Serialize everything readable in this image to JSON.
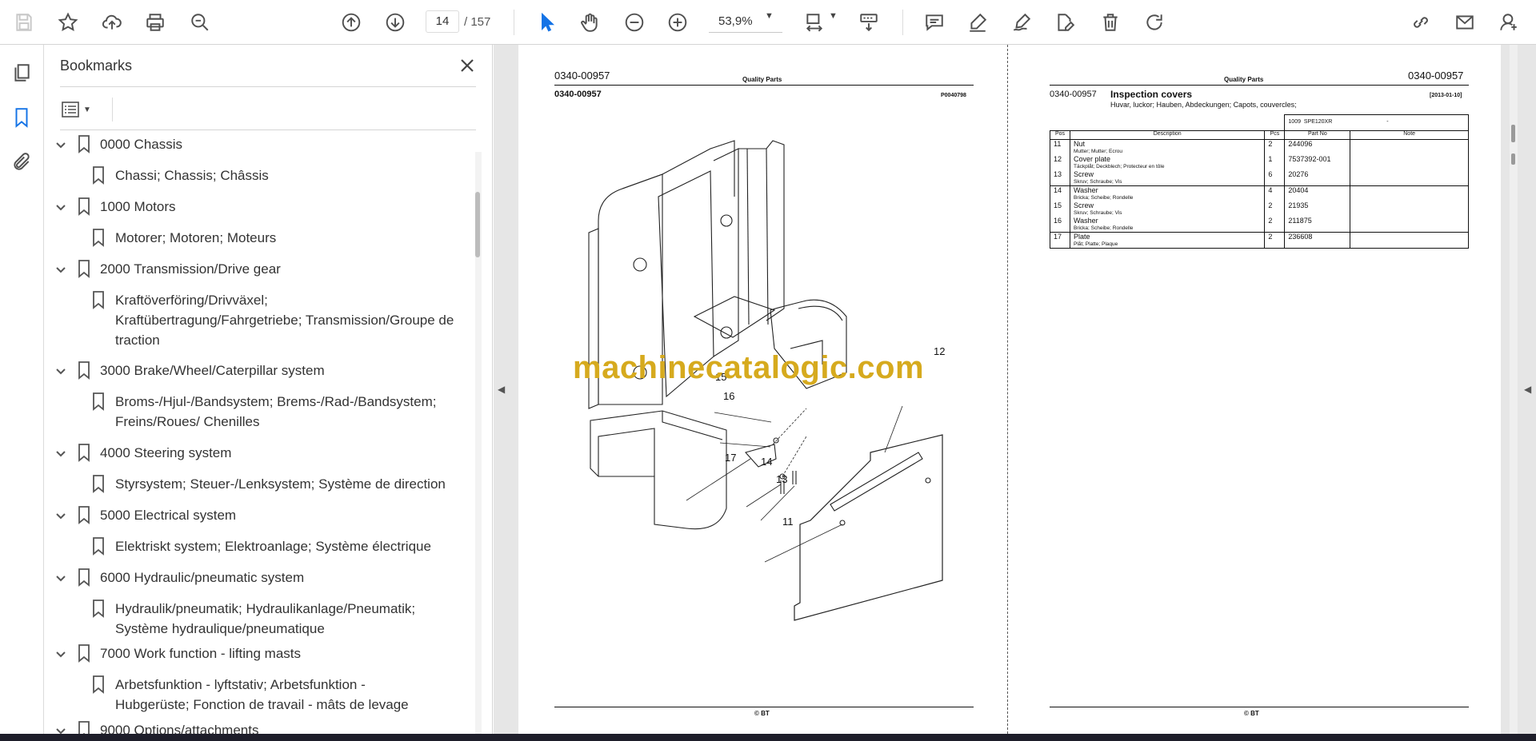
{
  "toolbar": {
    "page_current": "14",
    "page_total": "157",
    "page_separator": "/",
    "zoom": "53,9%"
  },
  "bookmarks": {
    "title": "Bookmarks",
    "items": [
      {
        "label": "0000 Chassis",
        "level": 0
      },
      {
        "label": "Chassi; Chassis; Châssis",
        "level": 1
      },
      {
        "label": "1000 Motors",
        "level": 0
      },
      {
        "label": "Motorer; Motoren; Moteurs",
        "level": 1
      },
      {
        "label": "2000 Transmission/Drive gear",
        "level": 0
      },
      {
        "label": "Kraftöverföring/Drivväxel;",
        "label2": "Kraftübertragung/Fahrgetriebe; Transmission/Groupe de",
        "label3": "traction",
        "level": 1
      },
      {
        "label": "3000 Brake/Wheel/Caterpillar system",
        "level": 0
      },
      {
        "label": "Broms-/Hjul-/Bandsystem; Brems-/Rad-/Bandsystem;",
        "label2": "Freins/Roues/ Chenilles",
        "level": 1
      },
      {
        "label": "4000 Steering system",
        "level": 0
      },
      {
        "label": "Styrsystem; Steuer-/Lenksystem; Système de direction",
        "level": 1
      },
      {
        "label": "5000 Electrical system",
        "level": 0
      },
      {
        "label": "Elektriskt system; Elektroanlage; Système électrique",
        "level": 1
      },
      {
        "label": "6000 Hydraulic/pneumatic system",
        "level": 0
      },
      {
        "label": "Hydraulik/pneumatik; Hydraulikanlage/Pneumatik;",
        "label2": "Système hydraulique/pneumatique",
        "level": 1
      },
      {
        "label": "7000 Work function - lifting masts",
        "level": 0
      },
      {
        "label": "Arbetsfunktion - lyftstativ; Arbetsfunktion -",
        "label2": "Hubgerüste; Fonction de travail - mâts de levage",
        "level": 1
      },
      {
        "label": "9000 Options/attachments",
        "level": 0
      }
    ]
  },
  "left_page": {
    "doc_no": "0340-00957",
    "header_center": "Quality Parts",
    "sub_doc_no": "0340-00957",
    "drawing_no": "P0040798",
    "footer": "© BT",
    "callouts": [
      "15",
      "16",
      "17",
      "14",
      "13",
      "11",
      "12"
    ]
  },
  "watermark": "machinecatalogic.com",
  "right_page": {
    "header_center": "Quality Parts",
    "doc_no": "0340-00957",
    "sub_doc_no": "0340-00957",
    "title": "Inspection covers",
    "subtitle": "Huvar, luckor; Hauben, Abdeckungen; Capots, couvercles;",
    "date": "[2013-01-10]",
    "model_code": "1009",
    "model_name": "SPE120XR",
    "model_dash": "-",
    "columns": [
      "Pos",
      "Description",
      "Pcs",
      "Part No",
      "Note"
    ],
    "rows": [
      {
        "pos": "11",
        "desc": "Nut",
        "sub": "Mutter; Mutter; Ecrou",
        "pcs": "2",
        "part": "244096"
      },
      {
        "pos": "12",
        "desc": "Cover plate",
        "sub": "Täckplåt; Deckblech; Protecteur en tôle",
        "pcs": "1",
        "part": "7537392-001"
      },
      {
        "pos": "13",
        "desc": "Screw",
        "sub": "Skruv; Schraube; Vis",
        "pcs": "6",
        "part": "20276"
      },
      {
        "pos": "14",
        "desc": "Washer",
        "sub": "Bricka; Scheibe; Rondelle",
        "pcs": "4",
        "part": "20404"
      },
      {
        "pos": "15",
        "desc": "Screw",
        "sub": "Skruv; Schraube; Vis",
        "pcs": "2",
        "part": "21935"
      },
      {
        "pos": "16",
        "desc": "Washer",
        "sub": "Bricka; Scheibe; Rondelle",
        "pcs": "2",
        "part": "211875"
      },
      {
        "pos": "17",
        "desc": "Plate",
        "sub": "Plåt; Platte; Plaque",
        "pcs": "2",
        "part": "236608"
      }
    ],
    "footer": "© BT"
  }
}
